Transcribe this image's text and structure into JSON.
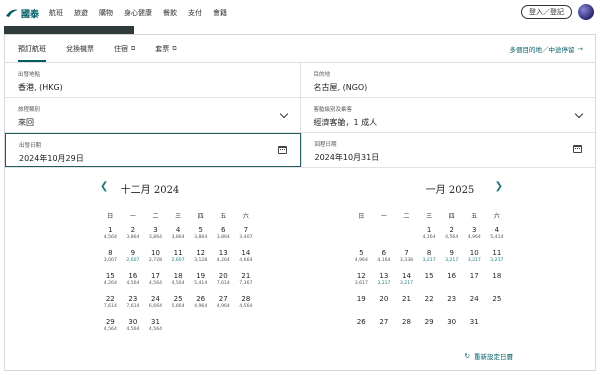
{
  "brand": "國泰",
  "nav": [
    "航班",
    "旅遊",
    "購物",
    "身心健康",
    "餐飲",
    "支付",
    "會籍"
  ],
  "login_label": "登入／登記",
  "tabs": [
    {
      "label": "預訂航班",
      "external": false,
      "active": true
    },
    {
      "label": "兌換機票",
      "external": false,
      "active": false
    },
    {
      "label": "住宿",
      "external": true,
      "active": false
    },
    {
      "label": "套票",
      "external": true,
      "active": false
    }
  ],
  "multi_city_label": "多個目的地／中途停留",
  "fields": {
    "origin_label": "出發地點",
    "origin_value": "香港, (HKG)",
    "dest_label": "目的地",
    "dest_value": "名古屋, (NGO)",
    "triptype_label": "旅程類別",
    "triptype_value": "來回",
    "class_label": "客艙級別及乘客",
    "class_value": "經濟客艙，1 成人",
    "depart_label": "出發日期",
    "depart_value": "2024年10月29日",
    "return_label": "回程日期",
    "return_value": "2024年10月31日"
  },
  "weekdays": [
    "日",
    "一",
    "二",
    "三",
    "四",
    "五",
    "六"
  ],
  "calendar_left": {
    "title": "十二月 2024",
    "offset": 0,
    "days": [
      {
        "d": "1",
        "p": "4,564"
      },
      {
        "d": "2",
        "p": "3,864"
      },
      {
        "d": "3",
        "p": "3,864"
      },
      {
        "d": "4",
        "p": "3,864"
      },
      {
        "d": "5",
        "p": "3,864"
      },
      {
        "d": "6",
        "p": "3,864"
      },
      {
        "d": "7",
        "p": "3,407"
      },
      {
        "d": "8",
        "p": "3,007"
      },
      {
        "d": "9",
        "p": "2,607",
        "low": true
      },
      {
        "d": "10",
        "p": "2,728"
      },
      {
        "d": "11",
        "p": "2,607",
        "low": true
      },
      {
        "d": "12",
        "p": "3,128"
      },
      {
        "d": "13",
        "p": "4,264"
      },
      {
        "d": "14",
        "p": "4,664"
      },
      {
        "d": "15",
        "p": "4,264"
      },
      {
        "d": "16",
        "p": "4,564"
      },
      {
        "d": "17",
        "p": "4,564"
      },
      {
        "d": "18",
        "p": "4,564"
      },
      {
        "d": "19",
        "p": "5,414"
      },
      {
        "d": "20",
        "p": "7,614"
      },
      {
        "d": "21",
        "p": "7,367"
      },
      {
        "d": "22",
        "p": "7,614"
      },
      {
        "d": "23",
        "p": "7,614"
      },
      {
        "d": "24",
        "p": "6,664"
      },
      {
        "d": "25",
        "p": "5,664"
      },
      {
        "d": "26",
        "p": "4,964"
      },
      {
        "d": "27",
        "p": "4,964"
      },
      {
        "d": "28",
        "p": "4,564"
      },
      {
        "d": "29",
        "p": "4,564"
      },
      {
        "d": "30",
        "p": "4,564"
      },
      {
        "d": "31",
        "p": "4,564"
      }
    ]
  },
  "calendar_right": {
    "title": "一月 2025",
    "offset": 3,
    "days": [
      {
        "d": "1",
        "p": "4,164"
      },
      {
        "d": "2",
        "p": "4,564"
      },
      {
        "d": "3",
        "p": "4,964"
      },
      {
        "d": "4",
        "p": "5,414"
      },
      {
        "d": "5",
        "p": "4,964"
      },
      {
        "d": "6",
        "p": "4,164"
      },
      {
        "d": "7",
        "p": "3,338"
      },
      {
        "d": "8",
        "p": "3,217",
        "low": true
      },
      {
        "d": "9",
        "p": "3,217",
        "low": true
      },
      {
        "d": "10",
        "p": "3,217",
        "low": true
      },
      {
        "d": "11",
        "p": "3,217",
        "low": true
      },
      {
        "d": "12",
        "p": "3,617"
      },
      {
        "d": "13",
        "p": "3,217",
        "low": true
      },
      {
        "d": "14",
        "p": "3,217",
        "low": true
      },
      {
        "d": "15",
        "p": ""
      },
      {
        "d": "16",
        "p": ""
      },
      {
        "d": "17",
        "p": ""
      },
      {
        "d": "18",
        "p": ""
      },
      {
        "d": "19",
        "p": ""
      },
      {
        "d": "20",
        "p": ""
      },
      {
        "d": "21",
        "p": ""
      },
      {
        "d": "22",
        "p": ""
      },
      {
        "d": "23",
        "p": ""
      },
      {
        "d": "24",
        "p": ""
      },
      {
        "d": "25",
        "p": ""
      },
      {
        "d": "26",
        "p": ""
      },
      {
        "d": "27",
        "p": ""
      },
      {
        "d": "28",
        "p": ""
      },
      {
        "d": "29",
        "p": ""
      },
      {
        "d": "30",
        "p": ""
      },
      {
        "d": "31",
        "p": ""
      }
    ]
  },
  "reset_label": "重新設定日曆",
  "colors": {
    "accent": "#005d63",
    "low_price": "#1a7a80"
  }
}
